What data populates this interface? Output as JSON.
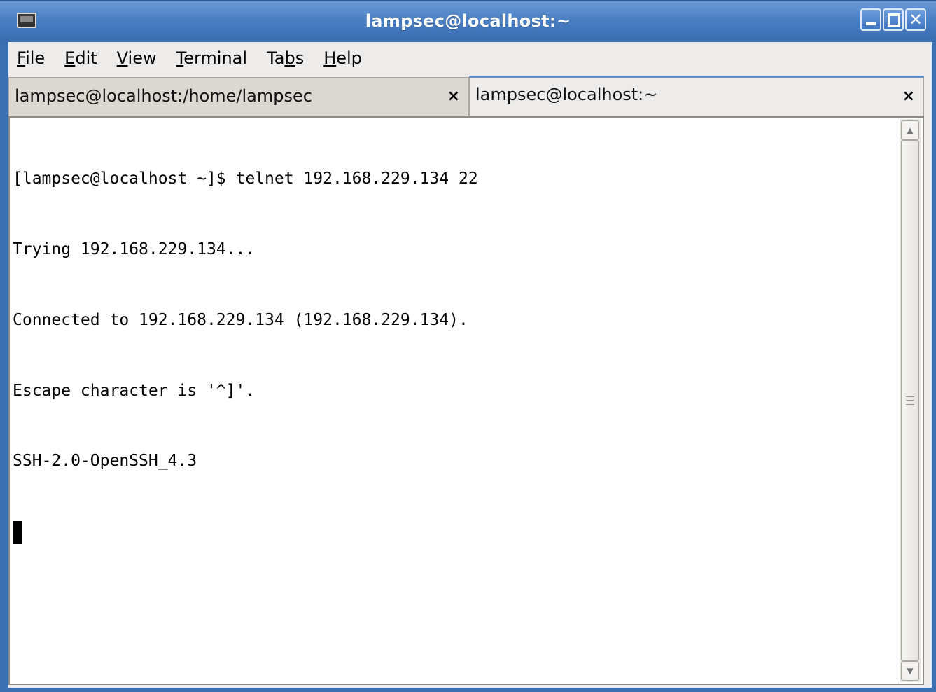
{
  "window": {
    "title": "lampsec@localhost:~"
  },
  "wm_buttons": {
    "close_glyph": "✕"
  },
  "menubar": {
    "items": [
      {
        "pre": "",
        "mnemonic": "F",
        "post": "ile"
      },
      {
        "pre": "",
        "mnemonic": "E",
        "post": "dit"
      },
      {
        "pre": "",
        "mnemonic": "V",
        "post": "iew"
      },
      {
        "pre": "",
        "mnemonic": "T",
        "post": "erminal"
      },
      {
        "pre": "Ta",
        "mnemonic": "b",
        "post": "s"
      },
      {
        "pre": "",
        "mnemonic": "H",
        "post": "elp"
      }
    ]
  },
  "tabs": [
    {
      "label": "lampsec@localhost:/home/lampsec",
      "close": "×",
      "active": false
    },
    {
      "label": "lampsec@localhost:~",
      "close": "×",
      "active": true
    }
  ],
  "terminal": {
    "lines": [
      "[lampsec@localhost ~]$ telnet 192.168.229.134 22",
      "Trying 192.168.229.134...",
      "Connected to 192.168.229.134 (192.168.229.134).",
      "Escape character is '^]'.",
      "SSH-2.0-OpenSSH_4.3"
    ]
  },
  "scrollbar": {
    "up_arrow": "▲",
    "down_arrow": "▼"
  }
}
